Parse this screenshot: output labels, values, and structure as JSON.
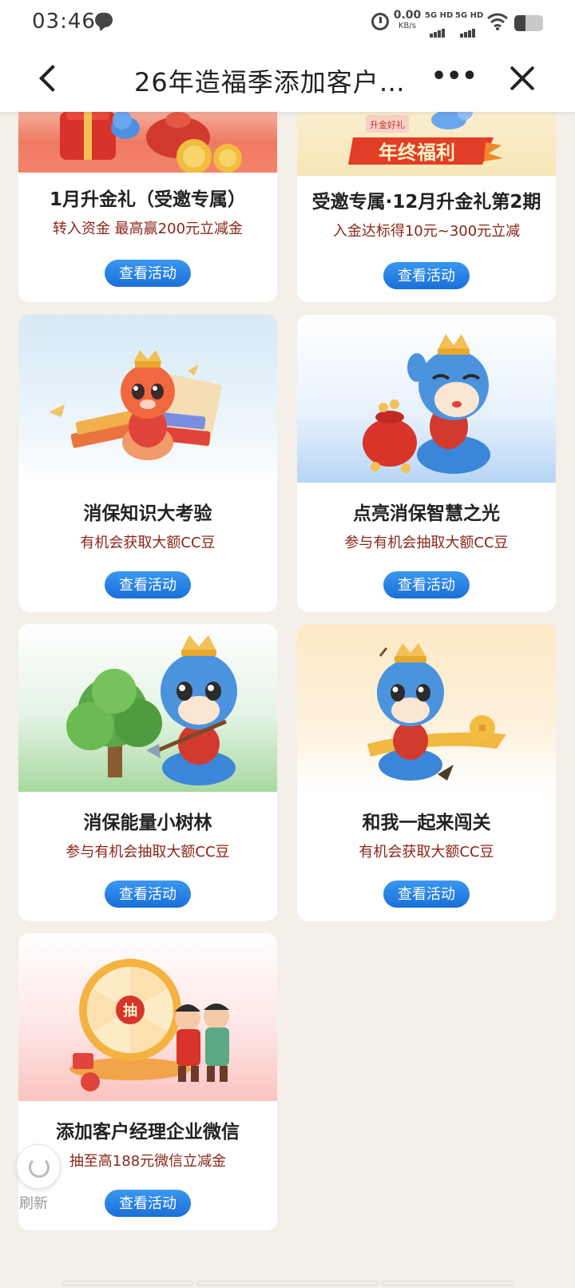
{
  "status_bar": {
    "time": "03:46",
    "net_speed": "0.00",
    "net_unit": "KB/s",
    "sim1": "5G HD",
    "sim2": "5G HD",
    "battery_level": 0.4
  },
  "nav": {
    "title": "26年造福季添加客户…",
    "more": "•••"
  },
  "cards": [
    {
      "title": "1月升金礼（受邀专属）",
      "subtitle": "转入资金 最高赢200元立减金",
      "button": "查看活动",
      "banner_text": ""
    },
    {
      "title": "受邀专属·12月升金礼第2期",
      "subtitle": "入金达标得10元~300元立减",
      "button": "查看活动",
      "banner_text": "年终福利",
      "banner_tag": "升金好礼"
    },
    {
      "title": "消保知识大考验",
      "subtitle": "有机会获取大额CC豆",
      "button": "查看活动"
    },
    {
      "title": "点亮消保智慧之光",
      "subtitle": "参与有机会抽取大额CC豆",
      "button": "查看活动"
    },
    {
      "title": "消保能量小树林",
      "subtitle": "参与有机会抽取大额CC豆",
      "button": "查看活动"
    },
    {
      "title": "和我一起来闯关",
      "subtitle": "有机会获取大额CC豆",
      "button": "查看活动"
    },
    {
      "title": "添加客户经理企业微信",
      "subtitle": "抽至高188元微信立减金",
      "button": "查看活动",
      "wheel_center": "抽"
    }
  ],
  "refresh": {
    "label": "刷新"
  },
  "colors": {
    "page_bg": "#f4efe9",
    "subtitle_red": "#8b2418",
    "button_blue": "#1a6fd8"
  }
}
